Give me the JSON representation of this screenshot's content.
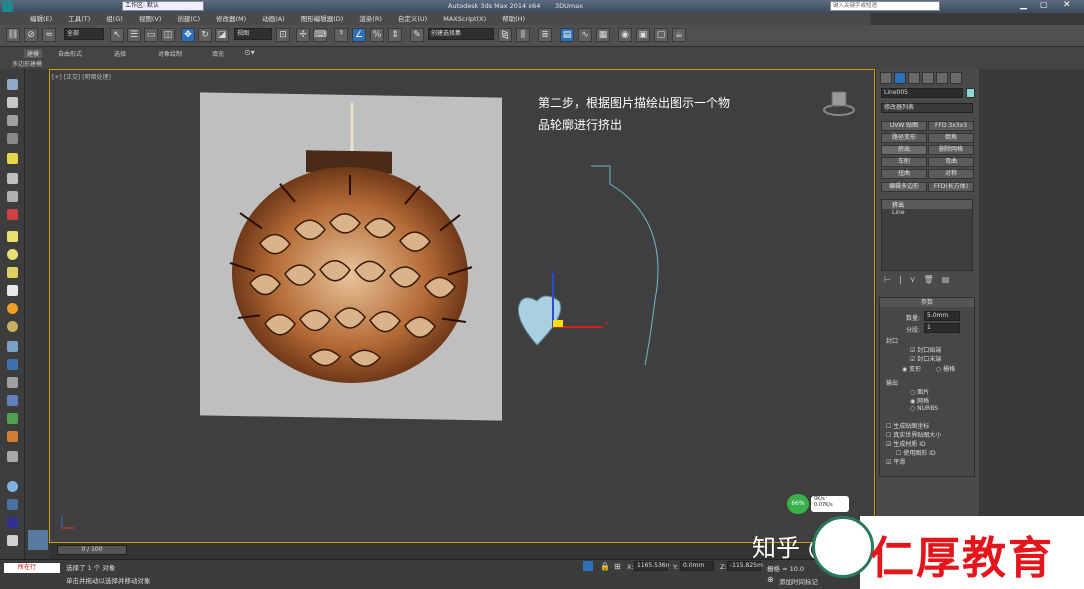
{
  "window": {
    "title": "Autodesk 3ds Max  2014 x64",
    "doc": "3DUmax",
    "workspace": "工作区: 默认",
    "search_placeholder": "键入关键字或短语"
  },
  "menu": [
    "编辑(E)",
    "工具(T)",
    "组(G)",
    "视图(V)",
    "创建(C)",
    "修改器(M)",
    "动画(A)",
    "图形编辑器(D)",
    "渲染(R)",
    "自定义(U)",
    "MAXScript(X)",
    "帮助(H)"
  ],
  "toolbar": {
    "selection_filter": "全部",
    "view_combo": "视图",
    "named_sets": "创建选择集"
  },
  "ribbon": {
    "tabs": [
      "建模",
      "自由形式",
      "选择",
      "对象绘制",
      "填充"
    ],
    "sub": "多边形建模"
  },
  "viewport": {
    "label": "[+] [正交] [明暗处理]",
    "caption_line1": "第二步，根据图片描绘出图示一个物",
    "caption_line2": "品轮廓进行挤出"
  },
  "command_panel": {
    "object_name": "Line005",
    "modifier_list": "修改器列表",
    "mod_buttons": [
      [
        "UVW 贴图",
        "FFD 3x3x3"
      ],
      [
        "路径变形",
        "倒角"
      ],
      [
        "挤出",
        "删除网格"
      ],
      [
        "车削",
        "弯曲"
      ],
      [
        "扭曲",
        "对称"
      ],
      [
        "编辑多边形",
        "FFD(长方体)"
      ]
    ],
    "stack": [
      "挤出",
      "Line"
    ],
    "params_title": "参数",
    "amount_label": "数量:",
    "amount_value": "5.0mm",
    "segments_label": "分段:",
    "segments_value": "1",
    "cap_title": "封口",
    "cap_start": "封口始端",
    "cap_end": "封口末端",
    "morph": "变形",
    "grid": "栅格",
    "output_title": "输出",
    "out_patch": "面片",
    "out_mesh": "网格",
    "out_nurbs": "NURBS",
    "gen_mapping": "生成贴图坐标",
    "real_world": "真实世界贴图大小",
    "gen_matid": "生成材质 ID",
    "use_shape_id": "使用图形 ID",
    "smooth": "平滑"
  },
  "timeline": {
    "frame": "0 / 100"
  },
  "status": {
    "selected": "选择了 1 个 对象",
    "prompt": "单击并拖动以选择并移动对象",
    "x_label": "X:",
    "x_value": "1165.536n",
    "y_label": "Y:",
    "y_value": "0.0mm",
    "z_label": "Z:",
    "z_value": "-115.825m",
    "grid_label": "栅格 = 10.0",
    "add_time": "添加时间标记",
    "mini_listener": "所在行"
  },
  "gpu": {
    "percent": "66%",
    "up": "0K/s",
    "down": "0.07K/s"
  },
  "watermark": {
    "zhihu": "知乎 @3DMAX资源库",
    "brand": "仁厚教育"
  },
  "colors": {
    "viewport_border": "#c8a000",
    "selected_blue": "#2d6fb8",
    "shape_cyan": "#a8d0e0",
    "brand_red": "#e4151b"
  }
}
